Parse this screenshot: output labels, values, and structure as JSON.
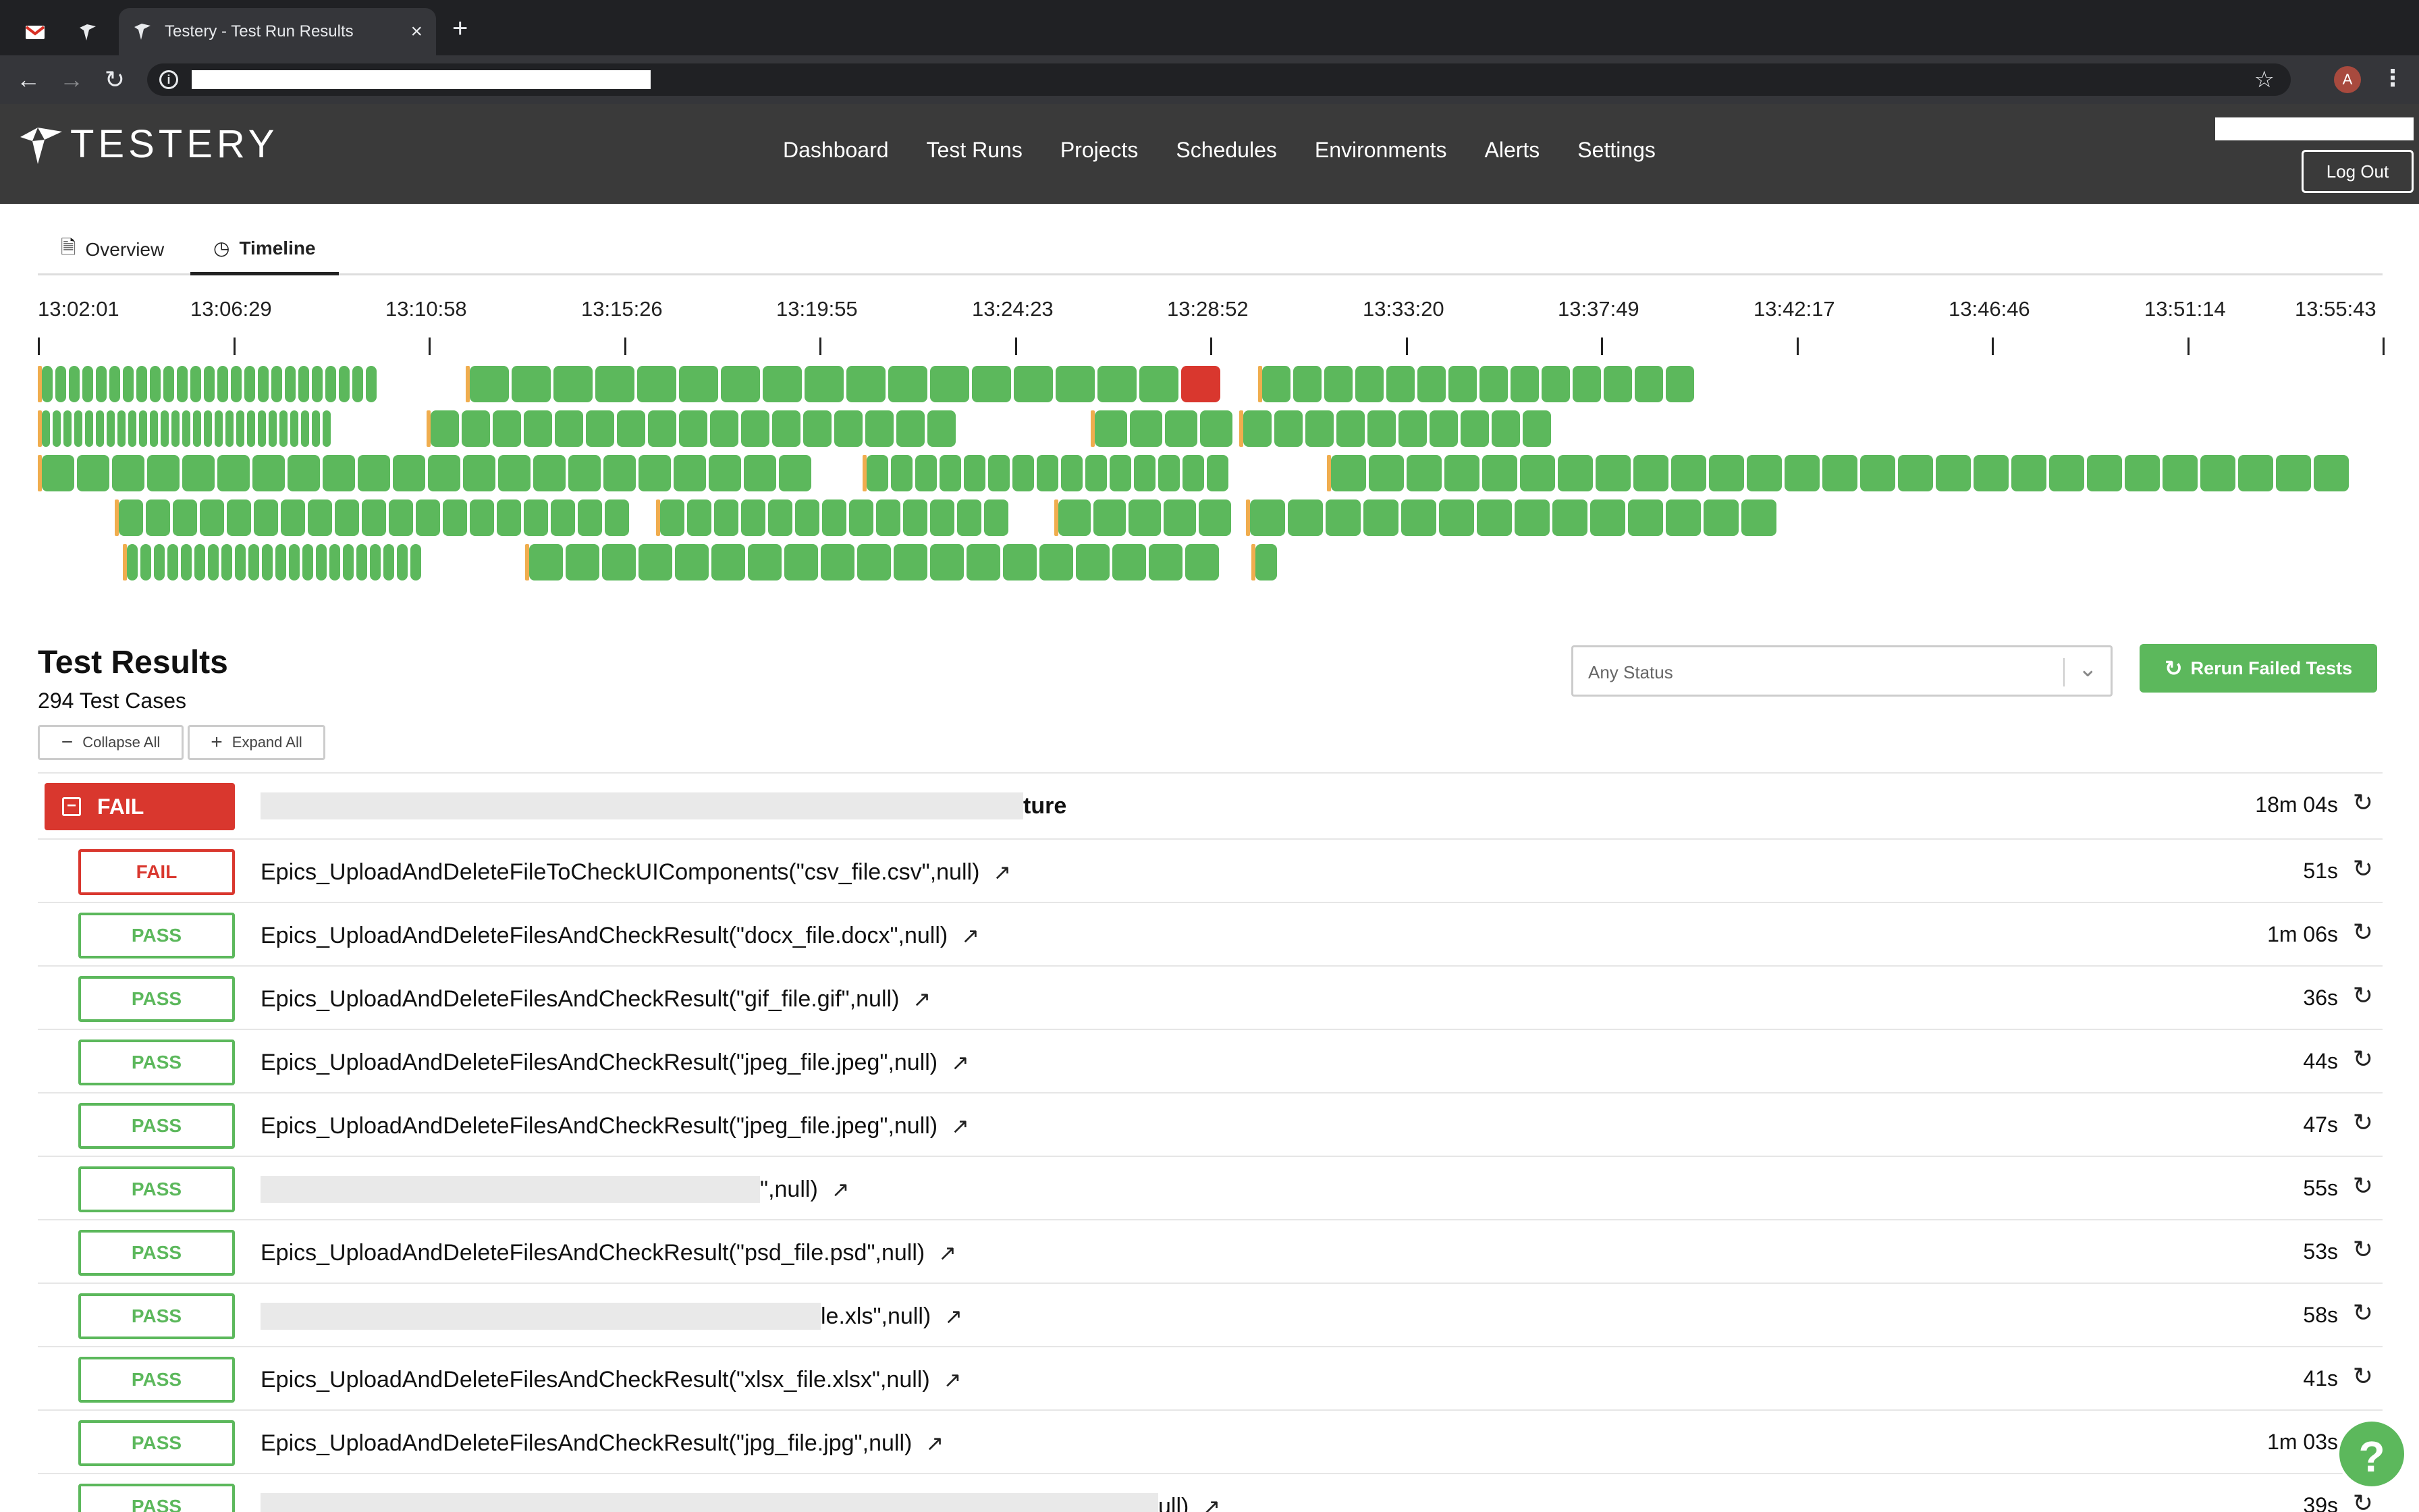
{
  "browser": {
    "tab_title": "Testery - Test Run Results",
    "tab_close": "×",
    "new_tab": "+",
    "profile_initial": "A"
  },
  "app": {
    "logo_text": "TESTERY",
    "nav": [
      "Dashboard",
      "Test Runs",
      "Projects",
      "Schedules",
      "Environments",
      "Alerts",
      "Settings"
    ],
    "logout_label": "Log Out"
  },
  "page_tabs": {
    "overview": "Overview",
    "timeline": "Timeline",
    "active": "Timeline"
  },
  "timeline": {
    "ticks": [
      "13:02:01",
      "13:06:29",
      "13:10:58",
      "13:15:26",
      "13:19:55",
      "13:24:23",
      "13:28:52",
      "13:33:20",
      "13:37:49",
      "13:42:17",
      "13:46:46",
      "13:51:14",
      "13:55:43"
    ],
    "colors": {
      "pass": "#5cb85c",
      "fail": "#d9372e",
      "start": "#f0ad4e"
    }
  },
  "results": {
    "title": "Test Results",
    "count_label": "294 Test Cases",
    "collapse_all": "Collapse All",
    "expand_all": "Expand All",
    "status_placeholder": "Any Status",
    "rerun_failed": "Rerun Failed Tests",
    "group": {
      "status": "FAIL",
      "name_visible": "ture",
      "duration": "18m 04s"
    },
    "rows": [
      {
        "status": "FAIL",
        "name_visible": "Epics_UploadAndDeleteFileToCheckUIComponents(\"csv_file.csv\",null)",
        "duration": "51s"
      },
      {
        "status": "PASS",
        "name_visible": "Epics_UploadAndDeleteFilesAndCheckResult(\"docx_file.docx\",null)",
        "duration": "1m 06s"
      },
      {
        "status": "PASS",
        "name_visible": "Epics_UploadAndDeleteFilesAndCheckResult(\"gif_file.gif\",null)",
        "duration": "36s"
      },
      {
        "status": "PASS",
        "name_visible": "Epics_UploadAndDeleteFilesAndCheckResult(\"jpeg_file.jpeg\",null)",
        "duration": "44s"
      },
      {
        "status": "PASS",
        "name_visible": "Epics_UploadAndDeleteFilesAndCheckResult(\"jpeg_file.jpeg\",null)",
        "duration": "47s"
      },
      {
        "status": "PASS",
        "name_visible": "\",null)",
        "duration": "55s"
      },
      {
        "status": "PASS",
        "name_visible": "Epics_UploadAndDeleteFilesAndCheckResult(\"psd_file.psd\",null)",
        "duration": "53s"
      },
      {
        "status": "PASS",
        "name_visible": "le.xls\",null)",
        "duration": "58s"
      },
      {
        "status": "PASS",
        "name_visible": "Epics_UploadAndDeleteFilesAndCheckResult(\"xlsx_file.xlsx\",null)",
        "duration": "41s"
      },
      {
        "status": "PASS",
        "name_visible": "Epics_UploadAndDeleteFilesAndCheckResult(\"jpg_file.jpg\",null)",
        "duration": "1m 03s"
      },
      {
        "status": "PASS",
        "name_visible": "ull)",
        "duration": "39s"
      }
    ]
  },
  "help_label": "?"
}
